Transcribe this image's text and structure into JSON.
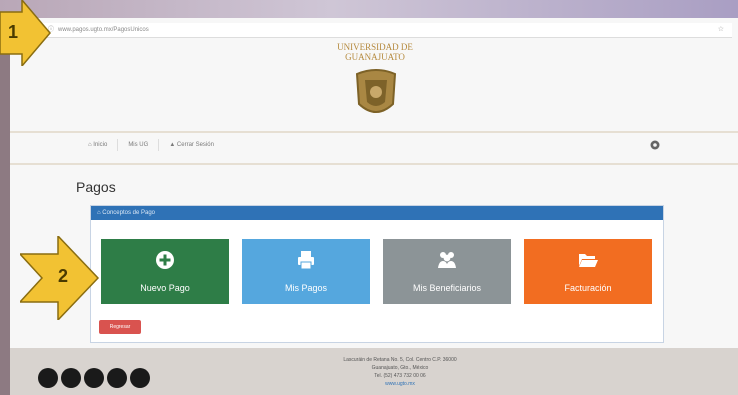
{
  "browser": {
    "url": "www.pagos.ugto.mx/PagosUnicos"
  },
  "header": {
    "university_line1": "UNIVERSIDAD DE",
    "university_line2": "GUANAJUATO"
  },
  "nav": {
    "home": "Inicio",
    "user": "Mis UG",
    "logout": "Cerrar Sesión"
  },
  "page": {
    "title": "Pagos",
    "panel_title": "Conceptos de Pago"
  },
  "tiles": [
    {
      "label": "Nuevo Pago",
      "color": "#2e7d47",
      "icon": "plus-circle-icon"
    },
    {
      "label": "Mis Pagos",
      "color": "#55a7de",
      "icon": "printer-icon"
    },
    {
      "label": "Mis Beneficiarios",
      "color": "#8c9497",
      "icon": "users-icon"
    },
    {
      "label": "Facturación",
      "color": "#f26d21",
      "icon": "folder-open-icon"
    }
  ],
  "back_button": "Regresar",
  "footer": {
    "line1": "Lascuráin de Retana No. 5, Col. Centro C.P. 36000",
    "line2": "Guanajuato, Gto., México",
    "line3": "Tel. (52) 473 732 00 06",
    "link": "www.ugto.mx"
  },
  "callouts": {
    "one": "1",
    "two": "2",
    "color": "#f2c233"
  }
}
